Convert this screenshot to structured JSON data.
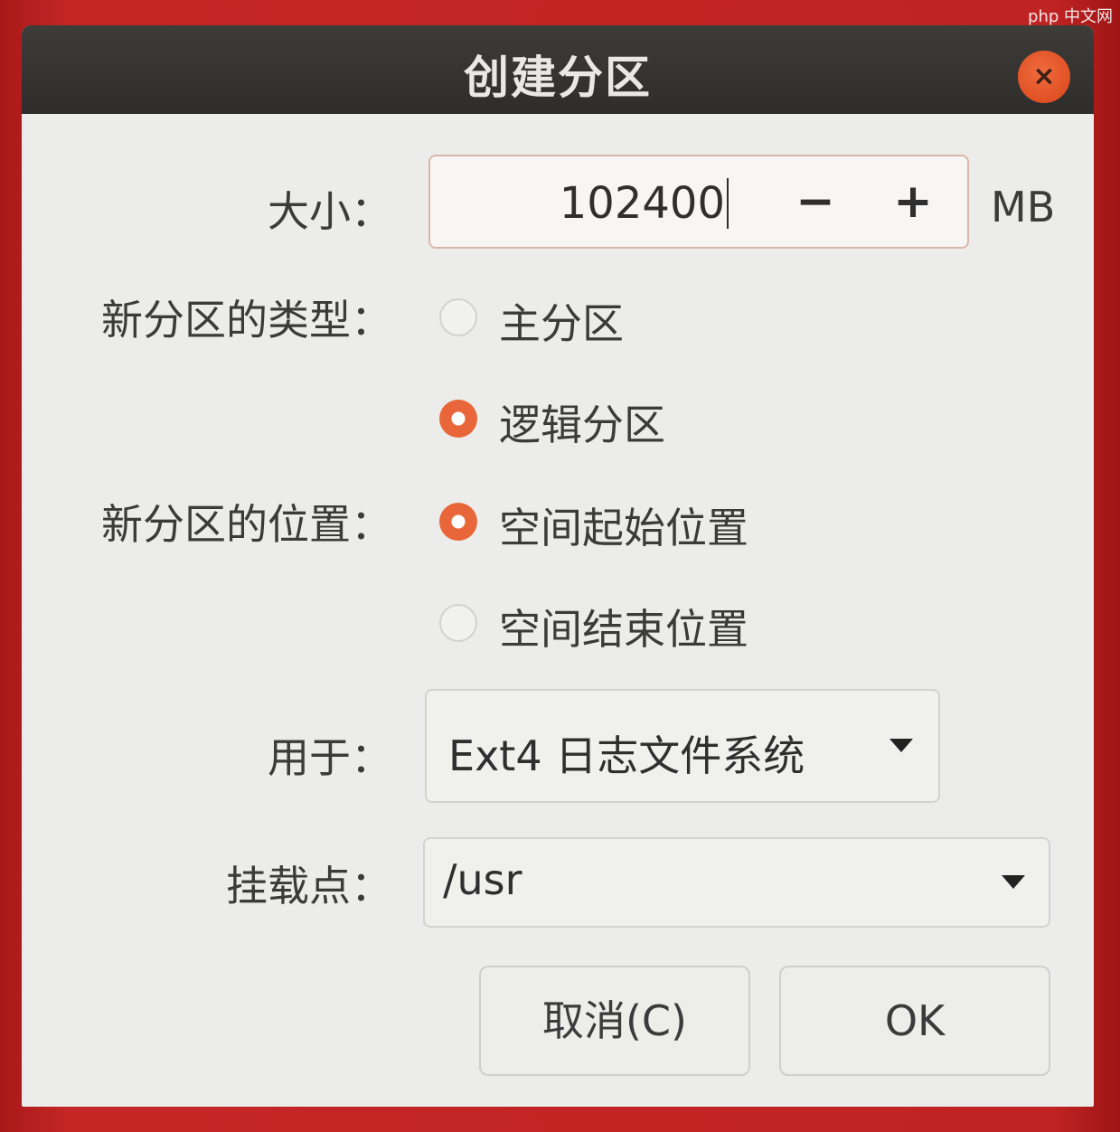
{
  "watermark": "php 中文网",
  "dialog": {
    "title": "创建分区",
    "close_symbol": "×"
  },
  "size": {
    "label": "大小：",
    "value": "102400",
    "minus": "−",
    "plus": "+",
    "unit": "MB"
  },
  "type": {
    "label": "新分区的类型：",
    "options": [
      {
        "label": "主分区",
        "selected": false
      },
      {
        "label": "逻辑分区",
        "selected": true
      }
    ]
  },
  "position": {
    "label": "新分区的位置：",
    "options": [
      {
        "label": "空间起始位置",
        "selected": true
      },
      {
        "label": "空间结束位置",
        "selected": false
      }
    ]
  },
  "use_as": {
    "label": "用于：",
    "value": "Ext4 日志文件系统"
  },
  "mount_point": {
    "label": "挂载点：",
    "value": "/usr"
  },
  "buttons": {
    "cancel": "取消(C)",
    "ok": "OK"
  },
  "colors": {
    "accent": "#e8663a",
    "titlebar": "#2e2d2b",
    "dialog_bg": "#ecedea"
  }
}
